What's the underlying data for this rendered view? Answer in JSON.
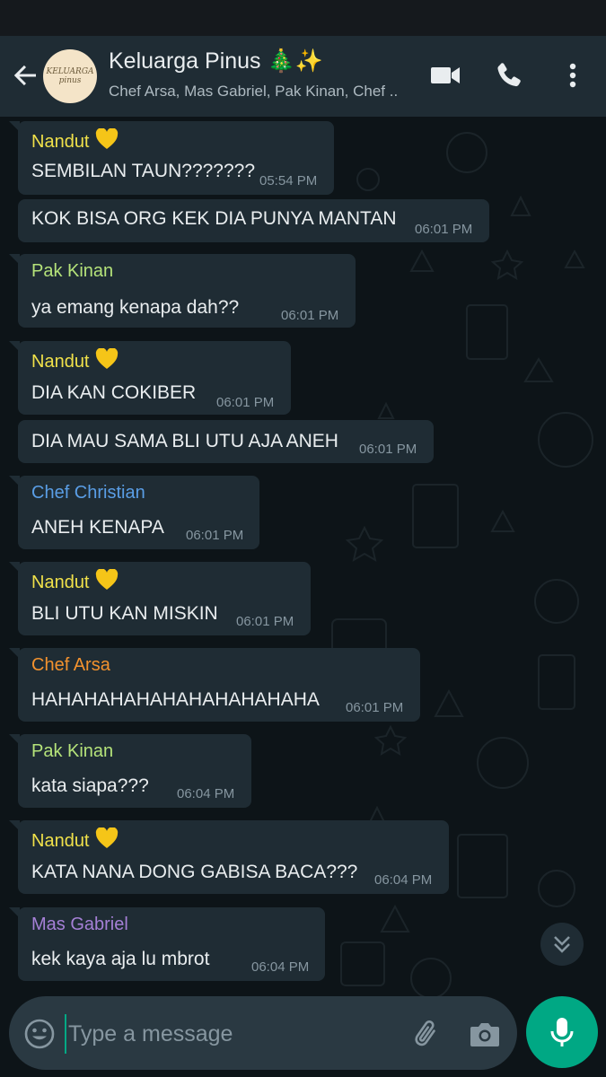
{
  "header": {
    "avatar_text": "KELUARGA pinus",
    "title": "Keluarga Pinus 🎄✨",
    "subtitle": "Chef Arsa, Mas Gabriel, Pak Kinan, Chef ..",
    "icons": [
      "back-arrow-icon",
      "video-call-icon",
      "voice-call-icon",
      "more-options-icon"
    ]
  },
  "colors": {
    "header_bg": "#1f2c34",
    "chat_bg": "#0d1418",
    "bubble_bg": "#1f2c34",
    "accent": "#00a884",
    "name_nandut": "#f0e14a",
    "name_pak_kinan": "#b5e37a",
    "name_chef_christian": "#5a9ee6",
    "name_chef_arsa": "#f3922e",
    "name_mas_gabriel": "#a580d6"
  },
  "messages": [
    {
      "sender": "Nandut",
      "heart": true,
      "text": "SEMBILAN TAUN???????",
      "time": "05:54 PM"
    },
    {
      "sender": "",
      "text": "KOK BISA ORG KEK DIA PUNYA MANTAN",
      "time": "06:01 PM"
    },
    {
      "sender": "Pak Kinan",
      "text": "ya emang kenapa dah??",
      "time": "06:01 PM"
    },
    {
      "sender": "Nandut",
      "heart": true,
      "text": "DIA KAN COKIBER",
      "time": "06:01 PM"
    },
    {
      "sender": "",
      "text": "DIA MAU SAMA BLI UTU AJA ANEH",
      "time": "06:01 PM"
    },
    {
      "sender": "Chef Christian",
      "text": "ANEH KENAPA",
      "time": "06:01 PM"
    },
    {
      "sender": "Nandut",
      "heart": true,
      "text": "BLI UTU KAN MISKIN",
      "time": "06:01 PM"
    },
    {
      "sender": "Chef Arsa",
      "text": "HAHAHAHAHAHAHAHAHAHAHA",
      "time": "06:01 PM"
    },
    {
      "sender": "Pak Kinan",
      "text": "kata siapa???",
      "time": "06:04 PM"
    },
    {
      "sender": "Nandut",
      "heart": true,
      "text": "KATA NANA DONG GABISA BACA???",
      "time": "06:04 PM"
    },
    {
      "sender": "Mas Gabriel",
      "text": "kek kaya aja lu mbrot",
      "time": "06:04 PM"
    }
  ],
  "composer": {
    "placeholder": "Type a message",
    "icons": [
      "emoji-icon",
      "attach-icon",
      "camera-icon",
      "mic-icon"
    ]
  }
}
